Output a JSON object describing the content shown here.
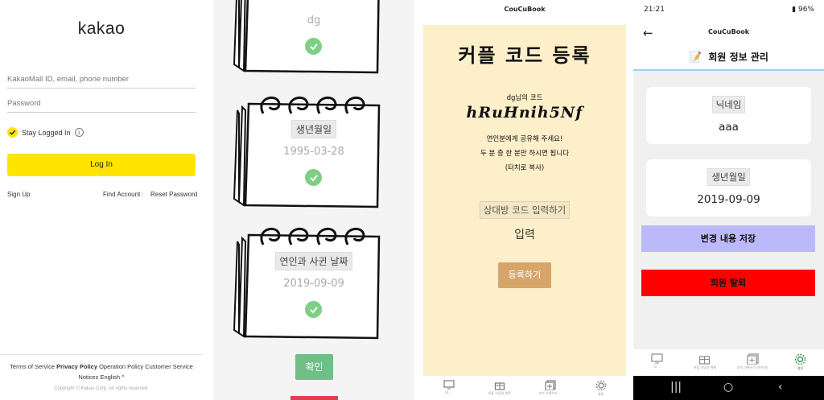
{
  "login": {
    "logo": "kakao",
    "id_placeholder": "KakaoMall ID, email, phone number",
    "password_placeholder": "Password",
    "stay_logged_in": "Stay Logged In",
    "login_button": "Log In",
    "sign_up": "Sign Up",
    "find_account": "Find Account",
    "reset_password": "Reset Password",
    "footer": {
      "terms": "Terms of Service",
      "privacy": "Privacy Policy",
      "operation": "Operation Policy",
      "customer": "Customer Service",
      "notices": "Notices",
      "language": "English",
      "copyright": "Copyright © Kakao Corp. All rights reserved."
    }
  },
  "notebook": {
    "top_value": "dg",
    "cards": [
      {
        "label": "생년월일",
        "value": "1995-03-28"
      },
      {
        "label": "연인과 사귄 날짜",
        "value": "2019-09-09"
      }
    ],
    "confirm": "확인"
  },
  "couple": {
    "app_title": "CouCuBook",
    "heading": "커플 코드 등록",
    "owner_line": "dg님의 코드",
    "code": "hRuHnih5Nf",
    "hint_1": "연인분에게 공유해 주세요!",
    "hint_2": "두 분 중 한 분만 하시면 됩니다",
    "hint_3": "(터치로 복사)",
    "partner_label": "상대방 코드 입력하기",
    "partner_placeholder": "입력",
    "register_button": "등록하기",
    "nav": [
      "내 ...",
      "커플 기념일 계획",
      "추억 기록하기 ...",
      "설정"
    ]
  },
  "profile": {
    "status_time": "21:21",
    "status_right": "96%",
    "app_title": "CouCuBook",
    "section_title": "회원 정보 관리",
    "nickname_label": "닉네임",
    "nickname_value": "aaa",
    "birthday_label": "생년월일",
    "birthday_value": "2019-09-09",
    "save_button": "변경 내용 저장",
    "leave_button": "회원 탈퇴",
    "nav": [
      "내 ...",
      "커플 기념일 계획",
      "추억 기록하기 (연인과)",
      "설정"
    ],
    "accent_color": "#9fd3ef",
    "save_color": "#bcb9fb",
    "leave_color": "#fe0000"
  }
}
